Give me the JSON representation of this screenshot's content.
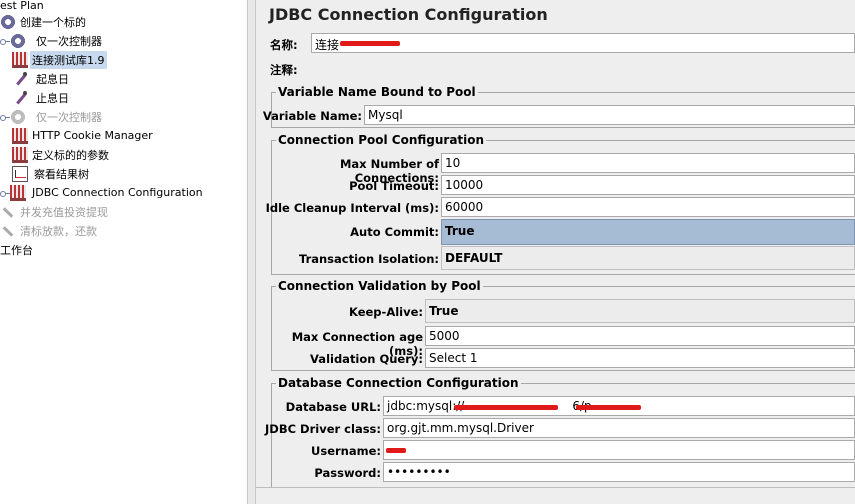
{
  "tree": {
    "items": [
      {
        "label": "est Plan",
        "icon": "test-plan-icon",
        "disabled": false,
        "selected": false
      },
      {
        "label": "创建一个标的",
        "icon": "gear-icon",
        "disabled": false,
        "selected": false
      },
      {
        "label": "仅一次控制器",
        "icon": "gear-icon",
        "disabled": false,
        "selected": false
      },
      {
        "label": "连接测试库1.9",
        "icon": "config-element-icon",
        "disabled": false,
        "selected": true
      },
      {
        "label": "起息日",
        "icon": "sampler-pipette-icon",
        "disabled": false,
        "selected": false
      },
      {
        "label": "止息日",
        "icon": "sampler-pipette-icon",
        "disabled": false,
        "selected": false
      },
      {
        "label": "仅一次控制器",
        "icon": "gear-icon",
        "disabled": true,
        "selected": false
      },
      {
        "label": "HTTP Cookie Manager",
        "icon": "config-element-icon",
        "disabled": false,
        "selected": false
      },
      {
        "label": "定义标的的参数",
        "icon": "config-element-icon",
        "disabled": false,
        "selected": false
      },
      {
        "label": "察看结果树",
        "icon": "listener-chart-icon",
        "disabled": false,
        "selected": false
      },
      {
        "label": "JDBC Connection Configuration",
        "icon": "config-element-icon",
        "disabled": false,
        "selected": false
      },
      {
        "label": "并发充值投资提现",
        "icon": "wrench-icon",
        "disabled": true,
        "selected": false
      },
      {
        "label": "清标放款，还款",
        "icon": "wrench-icon",
        "disabled": true,
        "selected": false
      },
      {
        "label": "工作台",
        "icon": "workbench-icon",
        "disabled": false,
        "selected": false
      }
    ]
  },
  "panel": {
    "title": "JDBC Connection Configuration",
    "name_label": "名称:",
    "name_value": "连接",
    "comment_label": "注释:",
    "comment_value": ""
  },
  "variable_group": {
    "legend": "Variable Name Bound to Pool",
    "variable_name_label": "Variable Name:",
    "variable_name_value": "Mysql"
  },
  "pool_group": {
    "legend": "Connection Pool Configuration",
    "max_conn_label": "Max Number of Connections:",
    "max_conn_value": "10",
    "timeout_label": "Pool Timeout:",
    "timeout_value": "10000",
    "cleanup_label": "Idle Cleanup Interval (ms):",
    "cleanup_value": "60000",
    "auto_commit_label": "Auto Commit:",
    "auto_commit_value": "True",
    "isolation_label": "Transaction Isolation:",
    "isolation_value": "DEFAULT"
  },
  "validation_group": {
    "legend": "Connection Validation by Pool",
    "keepalive_label": "Keep-Alive:",
    "keepalive_value": "True",
    "max_age_label": "Max Connection age (ms):",
    "max_age_value": "5000",
    "query_label": "Validation Query:",
    "query_value": "Select 1"
  },
  "db_group": {
    "legend": "Database Connection Configuration",
    "url_label": "Database URL:",
    "url_value": "jdbc:mysql://",
    "url_mid": "6/p",
    "driver_label": "JDBC Driver class:",
    "driver_value": "org.gjt.mm.mysql.Driver",
    "username_label": "Username:",
    "username_value": "",
    "password_label": "Password:",
    "password_value": "•••••••••"
  },
  "colors": {
    "selection": "#c7d9ee",
    "combo_selected": "#a6bbd4",
    "redaction": "#e01919"
  }
}
